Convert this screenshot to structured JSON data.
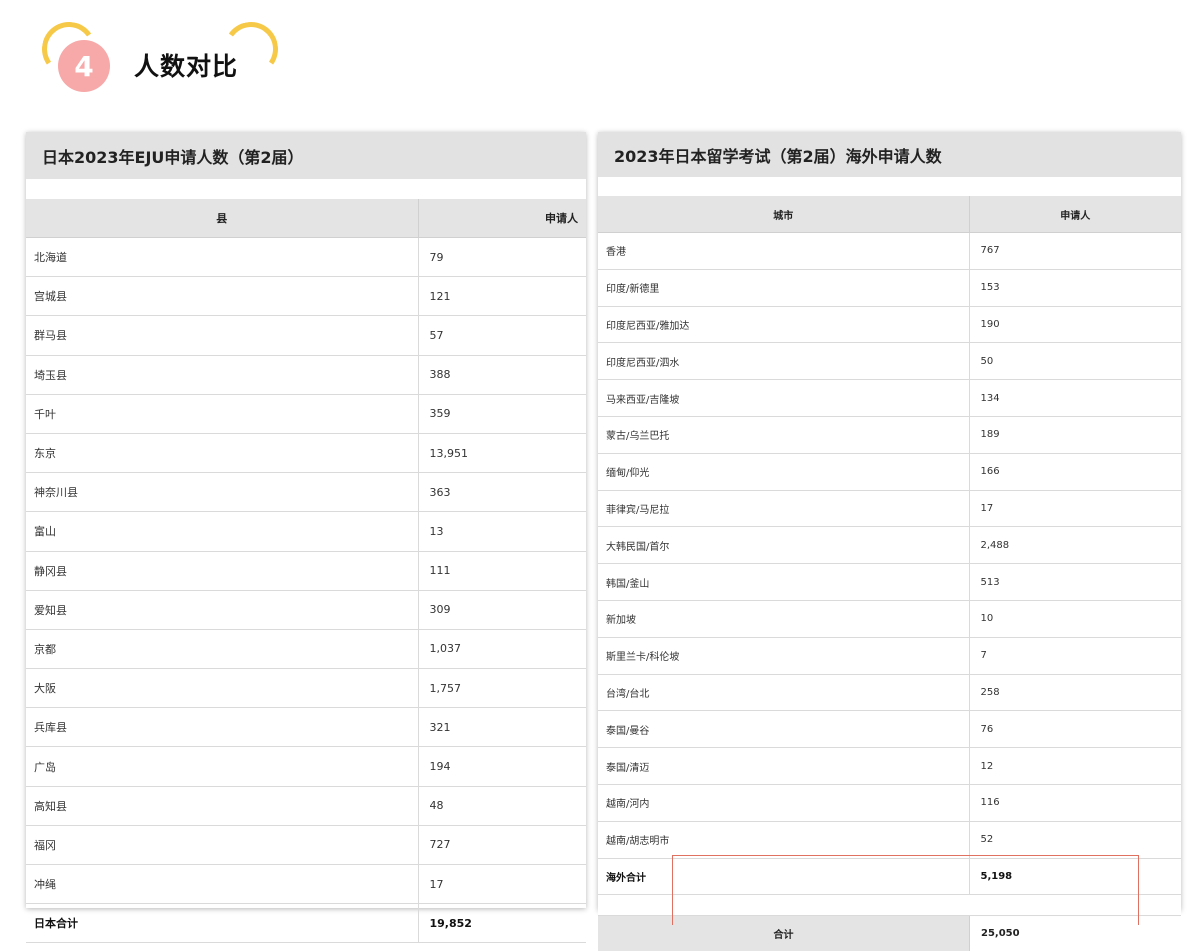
{
  "header": {
    "number": "4",
    "title": "人数对比",
    "accent_color": "#f7c948",
    "badge_color": "#f7a8a8"
  },
  "left_table": {
    "title": "日本2023年EJU申请人数（第2届）",
    "columns": [
      "县",
      "申请人"
    ],
    "rows": [
      [
        "北海道",
        "79"
      ],
      [
        "宫城县",
        "121"
      ],
      [
        "群马县",
        "57"
      ],
      [
        "埼玉县",
        "388"
      ],
      [
        "千叶",
        "359"
      ],
      [
        "东京",
        "13,951"
      ],
      [
        "神奈川县",
        "363"
      ],
      [
        "富山",
        "13"
      ],
      [
        "静冈县",
        "111"
      ],
      [
        "爱知县",
        "309"
      ],
      [
        "京都",
        "1,037"
      ],
      [
        "大阪",
        "1,757"
      ],
      [
        "兵库县",
        "321"
      ],
      [
        "广岛",
        "194"
      ],
      [
        "高知县",
        "48"
      ],
      [
        "福冈",
        "727"
      ],
      [
        "冲绳",
        "17"
      ]
    ],
    "total": [
      "日本合计",
      "19,852"
    ]
  },
  "right_table": {
    "title": "2023年日本留学考试（第2届）海外申请人数",
    "columns": [
      "城市",
      "申请人"
    ],
    "rows": [
      [
        "香港",
        "767"
      ],
      [
        "印度/新德里",
        "153"
      ],
      [
        "印度尼西亚/雅加达",
        "190"
      ],
      [
        "印度尼西亚/泗水",
        "50"
      ],
      [
        "马来西亚/吉隆坡",
        "134"
      ],
      [
        "蒙古/乌兰巴托",
        "189"
      ],
      [
        "缅甸/仰光",
        "166"
      ],
      [
        "菲律宾/马尼拉",
        "17"
      ],
      [
        "大韩民国/首尔",
        "2,488"
      ],
      [
        "韩国/釜山",
        "513"
      ],
      [
        "新加坡",
        "10"
      ],
      [
        "斯里兰卡/科伦坡",
        "7"
      ],
      [
        "台湾/台北",
        "258"
      ],
      [
        "泰国/曼谷",
        "76"
      ],
      [
        "泰国/清迈",
        "12"
      ],
      [
        "越南/河内",
        "116"
      ],
      [
        "越南/胡志明市",
        "52"
      ]
    ],
    "total": [
      "海外合计",
      "5,198"
    ],
    "grand_total": [
      "合计",
      "25,050"
    ]
  }
}
